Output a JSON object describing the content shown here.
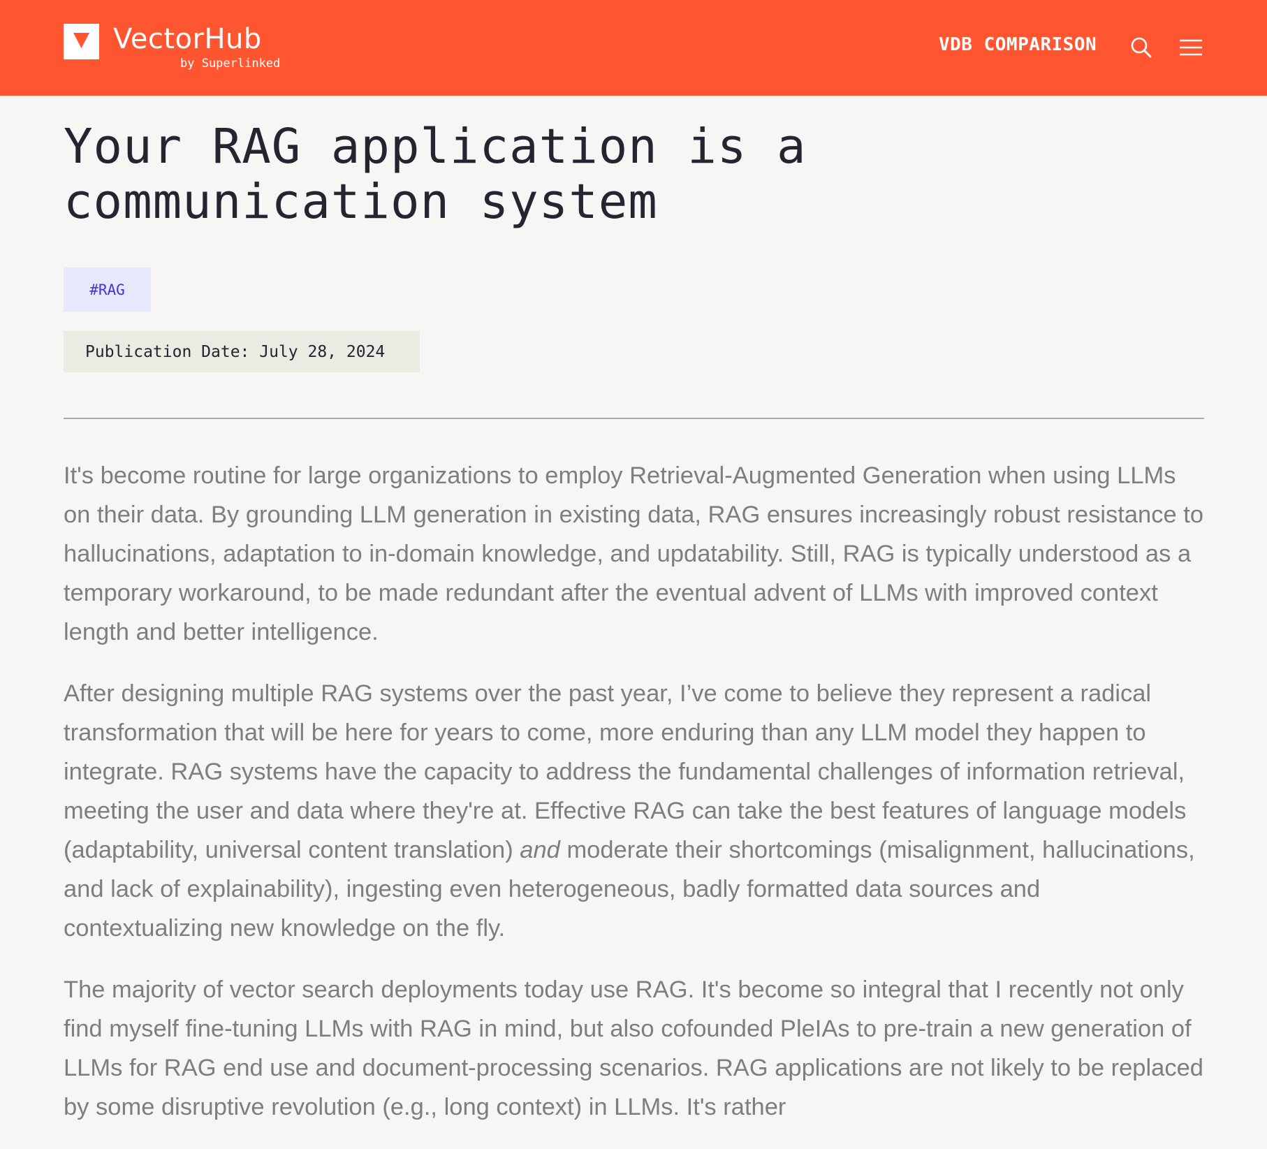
{
  "header": {
    "brand_name": "VectorHub",
    "brand_sub": "by Superlinked",
    "nav_link": "VDB COMPARISON",
    "search_icon": "search-icon",
    "menu_icon": "hamburger-menu-icon"
  },
  "colors": {
    "header_bg": "#ff5530",
    "page_bg": "#f7f6f5",
    "tag_bg": "#e7e7fd",
    "tag_text": "#3d3ad3",
    "date_bg": "#ebeae3",
    "body_text": "#7e7e7e"
  },
  "article": {
    "title_line1": "Your RAG application is a",
    "title_line2": "communication system",
    "tag": "#RAG",
    "publication_date": "Publication Date: July 28, 2024",
    "paragraph1": "It's become routine for large organizations to employ Retrieval-Augmented Generation when using LLMs on their data. By grounding LLM generation in existing data, RAG ensures increasingly robust resistance to hallucinations, adaptation to in-domain knowledge, and updatability. Still, RAG is typically understood as a temporary workaround, to be made redundant after the eventual advent of LLMs with improved context length and better intelligence.",
    "paragraph2_before": "After designing multiple RAG systems over the past year, I’ve come to believe they represent a radical transformation that will be here for years to come, more enduring than any LLM model they happen to integrate. RAG systems have the capacity to address the fundamental challenges of information retrieval, meeting the user and data where they're at. Effective RAG can take the best features of language models (adaptability, universal content translation) ",
    "paragraph2_emphasis": "and",
    "paragraph2_after": " moderate their shortcomings (misalignment, hallucinations, and lack of explainability), ingesting even heterogeneous, badly formatted data sources and contextualizing new knowledge on the fly.",
    "paragraph3": "The majority of vector search deployments today use RAG. It's become so integral that I recently not only find myself fine-tuning LLMs with RAG in mind, but also cofounded PleIAs to pre-train a new generation of LLMs for RAG end use and document-processing scenarios. RAG applications are not likely to be replaced by some disruptive revolution (e.g., long context) in LLMs. It's rather"
  }
}
